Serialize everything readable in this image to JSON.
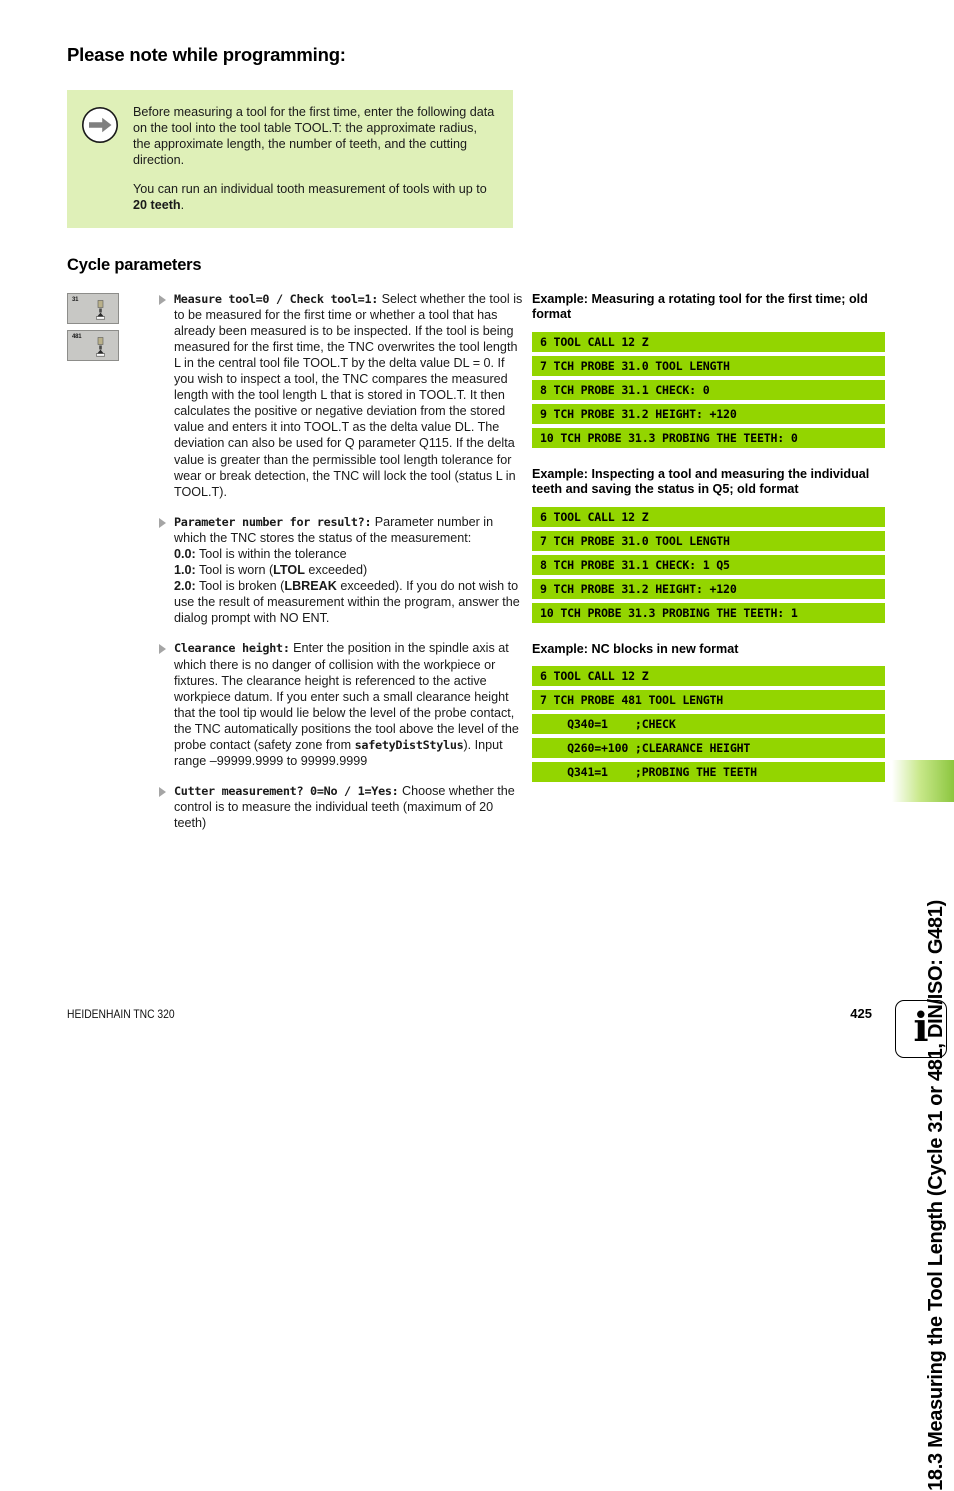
{
  "section_title": "Please note while programming:",
  "note": {
    "icon": "arrow-right-circle-icon",
    "paragraph1": "Before measuring a tool for the first time, enter the following data on the tool into the tool table TOOL.T: the approximate radius, the approximate length, the number of teeth, and the cutting direction.",
    "paragraph2_pre": "You can run an individual tooth measurement of tools with up to ",
    "paragraph2_bold": "20 teeth",
    "paragraph2_post": ".",
    "bg_color": "#dff0b8"
  },
  "cycle_parameters_heading": "Cycle parameters",
  "softkeys": [
    {
      "label": "31"
    },
    {
      "label": "481"
    }
  ],
  "parameters": [
    {
      "name": "Measure tool=0 / Check tool=1:",
      "text": " Select whether the tool is to be measured for the first time or whether a tool that has already been measured is to be inspected. If the tool is being measured for the first time, the TNC overwrites the tool length L in the central tool file TOOL.T by the delta value DL = 0. If you wish to inspect a tool, the TNC compares the measured length with the tool length L that is stored in TOOL.T. It then calculates the positive or negative deviation from the stored value and enters it into TOOL.T as the delta value DL. The deviation can also be used for Q parameter Q115. If the delta value is greater than the permissible tool length tolerance for wear or break detection, the TNC will lock the tool (status L in TOOL.T)."
    },
    {
      "name": "Parameter number for result?:",
      "text": " Parameter number in which the TNC stores the status of the measurement:",
      "status_lines": [
        {
          "code": "0.0:",
          "desc": " Tool is within the tolerance"
        },
        {
          "code": "1.0:",
          "desc": " Tool is worn (",
          "bold_term": "LTOL",
          "desc2": " exceeded)"
        },
        {
          "code": "2.0:",
          "desc": " Tool is broken (",
          "bold_term": "LBREAK",
          "desc2": " exceeded). If you do not wish to use the result of measurement within the program, answer the dialog prompt with NO ENT."
        }
      ]
    },
    {
      "name": "Clearance height:",
      "text": " Enter the position in the spindle axis at which there is no danger of collision with the workpiece or fixtures. The clearance height is referenced to the active workpiece datum. If you enter such a small clearance height that the tool tip would lie below the level of the probe contact, the TNC automatically positions the tool above the level of the probe contact (safety zone from ",
      "bold_term": "safetyDistStylus",
      "text2": "). Input range –99999.9999 to 99999.9999"
    },
    {
      "name": "Cutter measurement? 0=No / 1=Yes:",
      "text": " Choose whether the control is to measure the individual teeth (maximum of 20 teeth)"
    }
  ],
  "examples": [
    {
      "title": "Example: Measuring a rotating tool for the first time; old format",
      "lines": [
        "6 TOOL CALL 12 Z",
        "7 TCH PROBE 31.0 TOOL LENGTH",
        "8 TCH PROBE 31.1 CHECK: 0",
        "9 TCH PROBE 31.2 HEIGHT: +120",
        "10 TCH PROBE 31.3 PROBING THE TEETH: 0"
      ]
    },
    {
      "title": "Example: Inspecting a tool and measuring the individual teeth and saving the status in Q5; old format",
      "lines": [
        "6 TOOL CALL 12 Z",
        "7 TCH PROBE 31.0 TOOL LENGTH",
        "8 TCH PROBE 31.1 CHECK: 1 Q5",
        "9 TCH PROBE 31.2 HEIGHT: +120",
        "10 TCH PROBE 31.3 PROBING THE TEETH: 1"
      ]
    },
    {
      "title": "Example: NC blocks in new format",
      "lines": [
        "6 TOOL CALL 12 Z",
        "7 TCH PROBE 481 TOOL LENGTH",
        "    Q340=1    ;CHECK",
        "    Q260=+100 ;CLEARANCE HEIGHT",
        "    Q341=1    ;PROBING THE TEETH"
      ]
    }
  ],
  "side_title": "18.3 Measuring the Tool Length (Cycle 31 or 481, DIN/ISO: G481)",
  "footer": {
    "left": "HEIDENHAIN TNC 320",
    "page_number": "425",
    "info_glyph": "i"
  },
  "colors": {
    "code_green": "#93d500",
    "note_green": "#dff0b8",
    "tab_green": "#8cc63f"
  }
}
